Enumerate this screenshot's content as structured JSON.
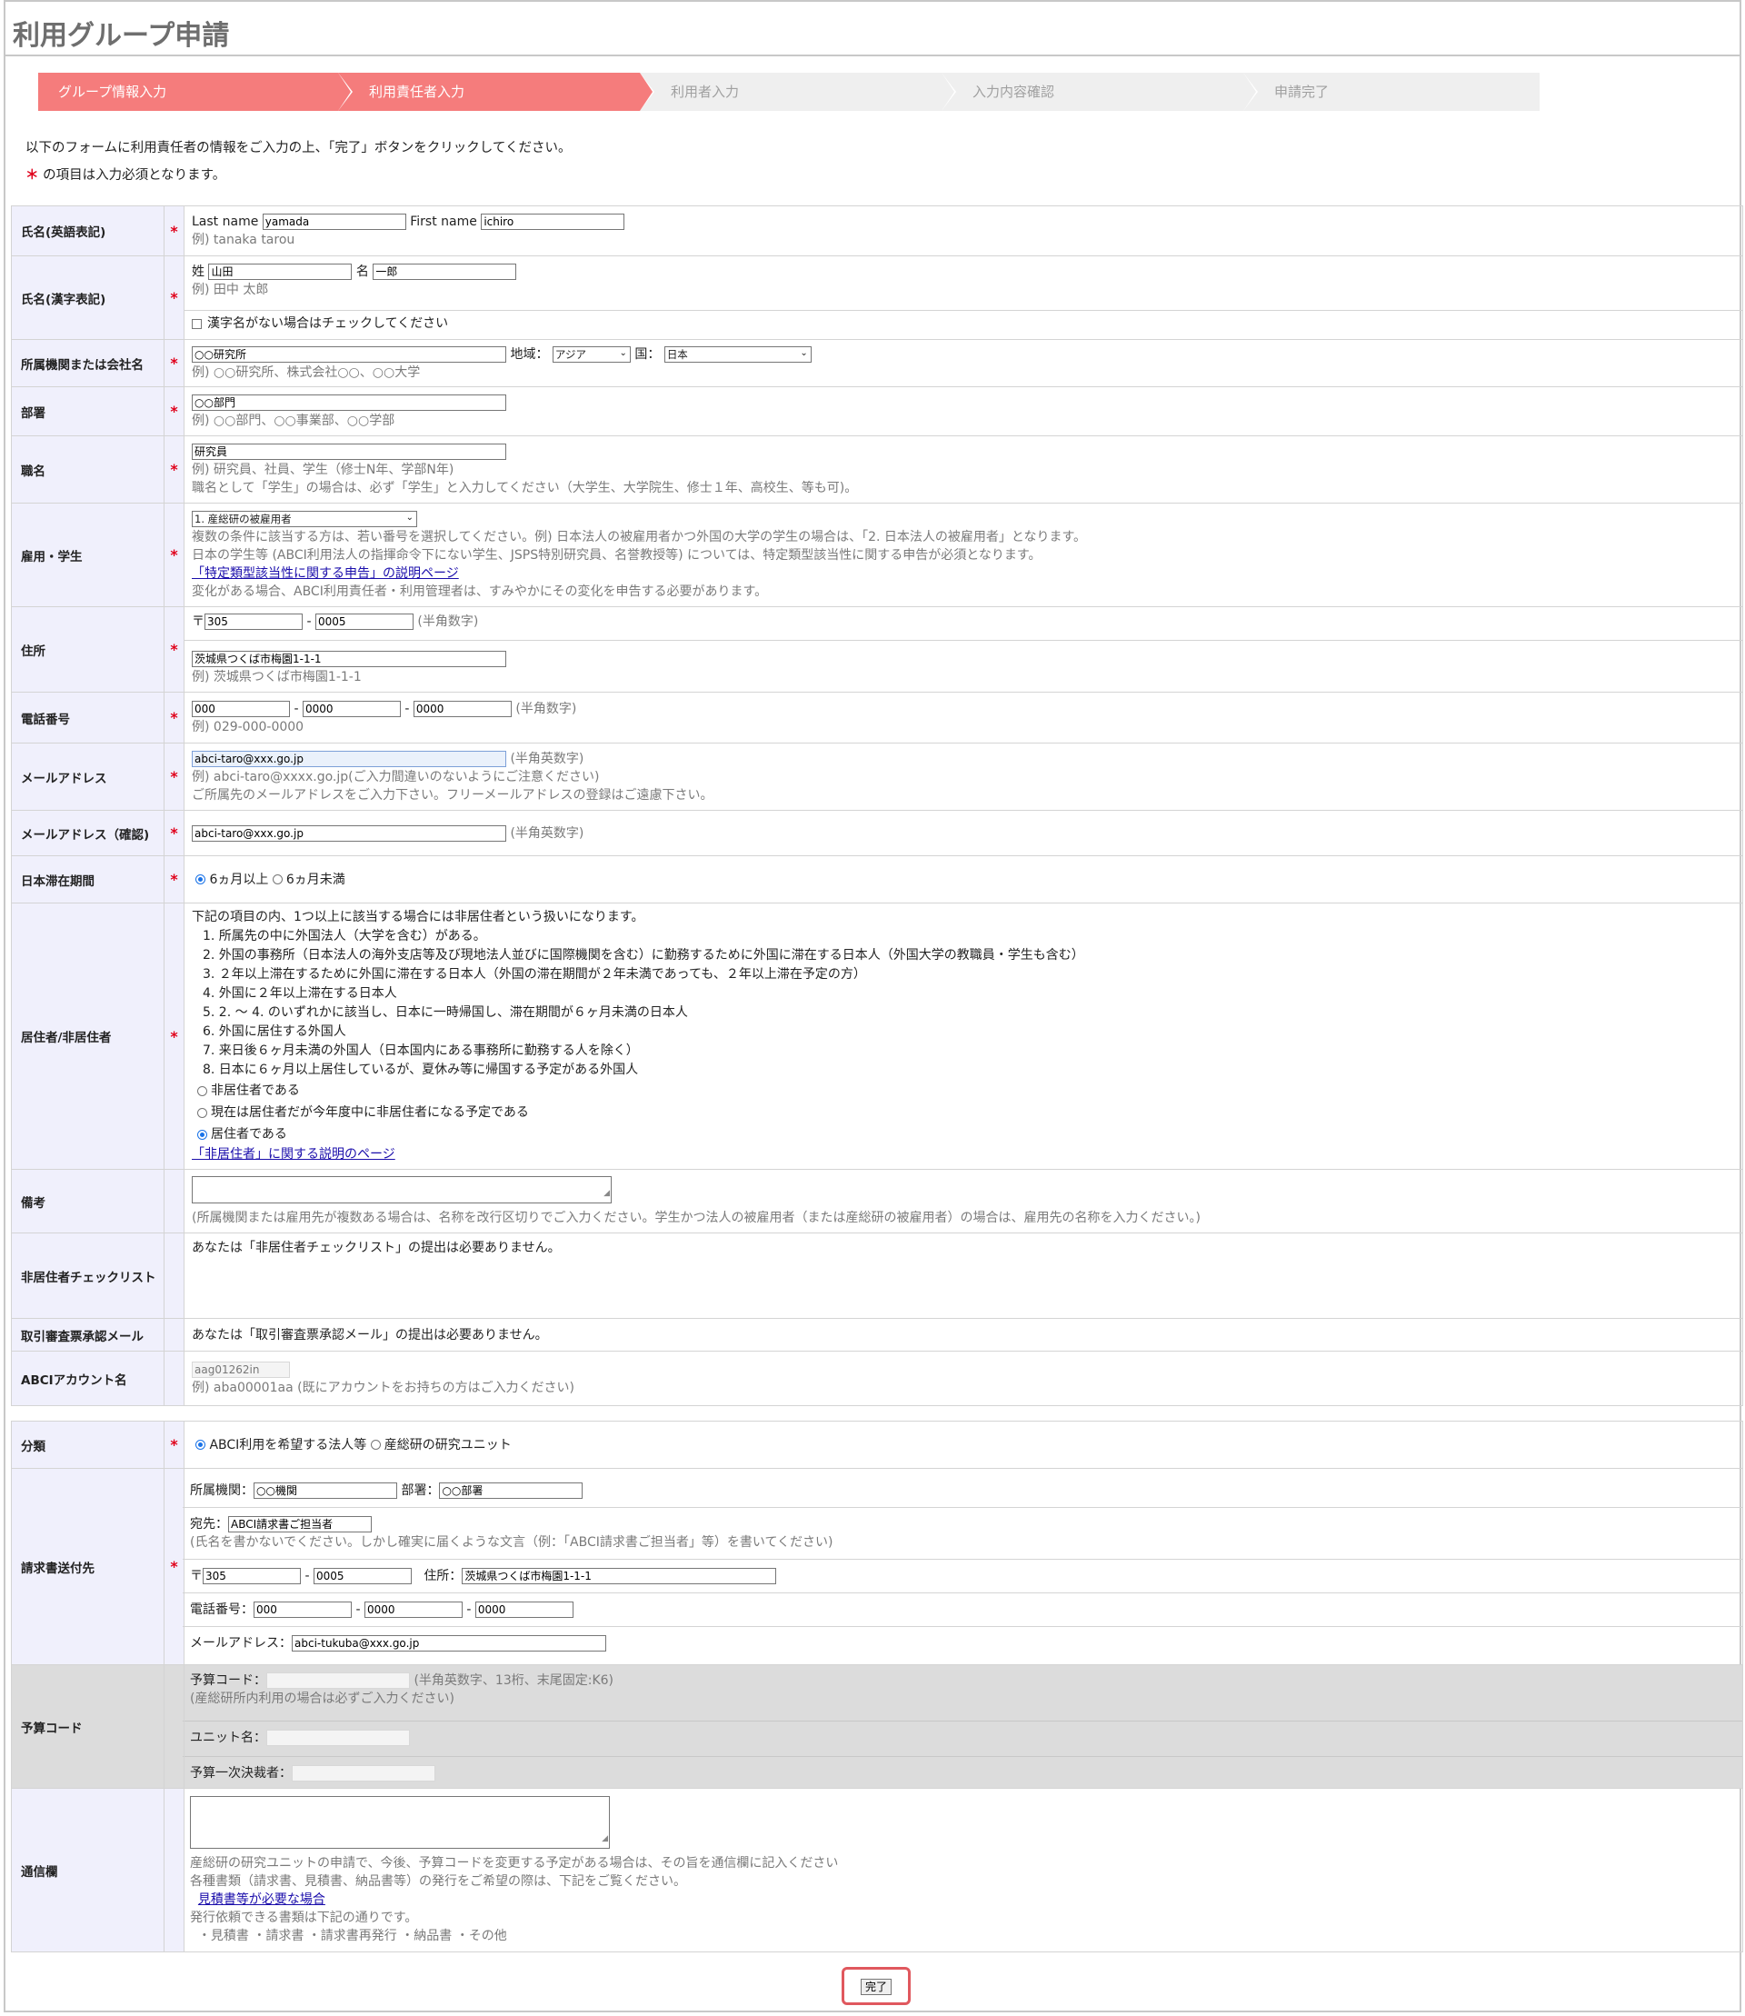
{
  "title": "利用グループ申請",
  "steps": [
    "グループ情報入力",
    "利用責任者入力",
    "利用者入力",
    "入力内容確認",
    "申請完了"
  ],
  "intro": {
    "line1": "以下のフォームに利用責任者の情報をご入力の上、「完了」ボタンをクリックしてください。",
    "required_mark": "＊",
    "line2": " の項目は入力必須となります。"
  },
  "fields": {
    "name_en": {
      "label": "氏名(英語表記)",
      "last_label": "Last name",
      "last_value": "yamada",
      "first_label": "First name",
      "first_value": "ichiro",
      "example": "例) tanaka tarou"
    },
    "name_kanji": {
      "label": "氏名(漢字表記)",
      "sei_label": "姓",
      "sei_value": "山田",
      "mei_label": "名",
      "mei_value": "一郎",
      "example": "例) 田中 太郎",
      "checkbox_label": "漢字名がない場合はチェックしてください"
    },
    "affiliation": {
      "label": "所属機関または会社名",
      "value": "○○研究所",
      "region_label": "地域：",
      "region_value": "アジア",
      "country_label": "国：",
      "country_value": "日本",
      "example": "例) ○○研究所、株式会社○○、○○大学"
    },
    "department": {
      "label": "部署",
      "value": "○○部門",
      "example": "例) ○○部門、○○事業部、○○学部"
    },
    "position": {
      "label": "職名",
      "value": "研究員",
      "example": "例) 研究員、社員、学生（修士N年、学部N年)",
      "note": "職名として「学生」の場合は、必ず「学生」と入力してください（大学生、大学院生、修士１年、高校生、等も可)。"
    },
    "employment": {
      "label": "雇用・学生",
      "value": "1. 産総研の被雇用者",
      "note1": "複数の条件に該当する方は、若い番号を選択してください。例) 日本法人の被雇用者かつ外国の大学の学生の場合は、「2. 日本法人の被雇用者」となります。",
      "note2": "日本の学生等 (ABCI利用法人の指揮命令下にない学生、JSPS特別研究員、名誉教授等) については、特定類型該当性に関する申告が必須となります。",
      "link": "「特定類型該当性に関する申告」の説明ページ",
      "note3": "変化がある場合、ABCI利用責任者・利用管理者は、すみやかにその変化を申告する必要があります。"
    },
    "address": {
      "label": "住所",
      "postal_prefix": "〒",
      "zip1": "305",
      "zip2": "0005",
      "zip_hint": "(半角数字)",
      "value": "茨城県つくば市梅園1-1-1",
      "example": "例) 茨城県つくば市梅園1-1-1"
    },
    "phone": {
      "label": "電話番号",
      "p1": "000",
      "p2": "0000",
      "p3": "0000",
      "hint": "(半角数字)",
      "example": "例) 029-000-0000"
    },
    "email": {
      "label": "メールアドレス",
      "value": "abci-taro@xxx.go.jp",
      "hint": "(半角英数字)",
      "example": "例) abci-taro@xxxx.go.jp(ご入力間違いのないようにご注意ください)",
      "note": "ご所属先のメールアドレスをご入力下さい。フリーメールアドレスの登録はご遠慮下さい。"
    },
    "email_confirm": {
      "label": "メールアドレス（確認)",
      "value": "abci-taro@xxx.go.jp",
      "hint": "(半角英数字)"
    },
    "stay": {
      "label": "日本滞在期間",
      "opt1": "6ヵ月以上",
      "opt2": "6ヵ月未満"
    },
    "residency": {
      "label": "居住者/非居住者",
      "intro": "下記の項目の内、1つ以上に該当する場合には非居住者という扱いになります。",
      "items": [
        "1. 所属先の中に外国法人（大学を含む）がある。",
        "2. 外国の事務所（日本法人の海外支店等及び現地法人並びに国際機関を含む）に勤務するために外国に滞在する日本人（外国大学の教職員・学生も含む）",
        "3. ２年以上滞在するために外国に滞在する日本人（外国の滞在期間が２年未満であっても、２年以上滞在予定の方）",
        "4. 外国に２年以上滞在する日本人",
        "5. 2. ～ 4. のいずれかに該当し、日本に一時帰国し、滞在期間が６ヶ月未満の日本人",
        "6. 外国に居住する外国人",
        "7. 来日後６ヶ月未満の外国人（日本国内にある事務所に勤務する人を除く）",
        "8. 日本に６ヶ月以上居住しているが、夏休み等に帰国する予定がある外国人"
      ],
      "opt1": "非居住者である",
      "opt2": "現在は居住者だが今年度中に非居住者になる予定である",
      "opt3": "居住者である",
      "link": "「非居住者」に関する説明のページ"
    },
    "remarks": {
      "label": "備考",
      "note": "(所属機関または雇用先が複数ある場合は、名称を改行区切りでご入力ください。学生かつ法人の被雇用者（または産総研の被雇用者）の場合は、雇用先の名称を入力ください。)"
    },
    "nonresident_checklist": {
      "label": "非居住者チェックリスト",
      "text": "あなたは「非居住者チェックリスト」の提出は必要ありません。"
    },
    "trade_mail": {
      "label": "取引審査票承認メール",
      "text": "あなたは「取引審査票承認メール」の提出は必要ありません。"
    },
    "abci_account": {
      "label": "ABCIアカウント名",
      "value": "aag01262in",
      "example": "例) aba00001aa (既にアカウントをお持ちの方はご入力ください)"
    }
  },
  "billing": {
    "category": {
      "label": "分類",
      "opt1": "ABCI利用を希望する法人等",
      "opt2": "産総研の研究ユニット"
    },
    "invoice": {
      "label": "請求書送付先",
      "org_label": "所属機関：",
      "org_value": "○○機関",
      "dept_label": "部署：",
      "dept_value": "○○部署",
      "to_label": "宛先：",
      "to_value": "ABCI請求書ご担当者",
      "to_note": "(氏名を書かないでください。しかし確実に届くような文言（例：「ABCI請求書ご担当者」等）を書いてください)",
      "postal_prefix": "〒",
      "zip1": "305",
      "zip2": "0005",
      "addr_label": "住所：",
      "addr_value": "茨城県つくば市梅園1-1-1",
      "phone_label": "電話番号：",
      "p1": "000",
      "p2": "0000",
      "p3": "0000",
      "mail_label": "メールアドレス：",
      "mail_value": "abci-tukuba@xxx.go.jp"
    },
    "budget": {
      "label": "予算コード",
      "code_label": "予算コード：",
      "code_hint": "(半角英数字、13桁、末尾固定:K6)",
      "code_note": "(産総研所内利用の場合は必ずご入力ください)",
      "unit_label": "ユニット名：",
      "approver_label": "予算一次決裁者："
    },
    "comm": {
      "label": "通信欄",
      "note1": "産総研の研究ユニットの申請で、今後、予算コードを変更する予定がある場合は、その旨を通信欄に記入ください",
      "note2": "各種書類（請求書、見積書、納品書等）の発行をご希望の際は、下記をご覧ください。",
      "link": "見積書等が必要な場合",
      "note3": "発行依頼できる書類は下記の通りです。",
      "note4": "・見積書 ・請求書 ・請求書再発行 ・納品書 ・その他"
    }
  },
  "submit_label": "完了"
}
